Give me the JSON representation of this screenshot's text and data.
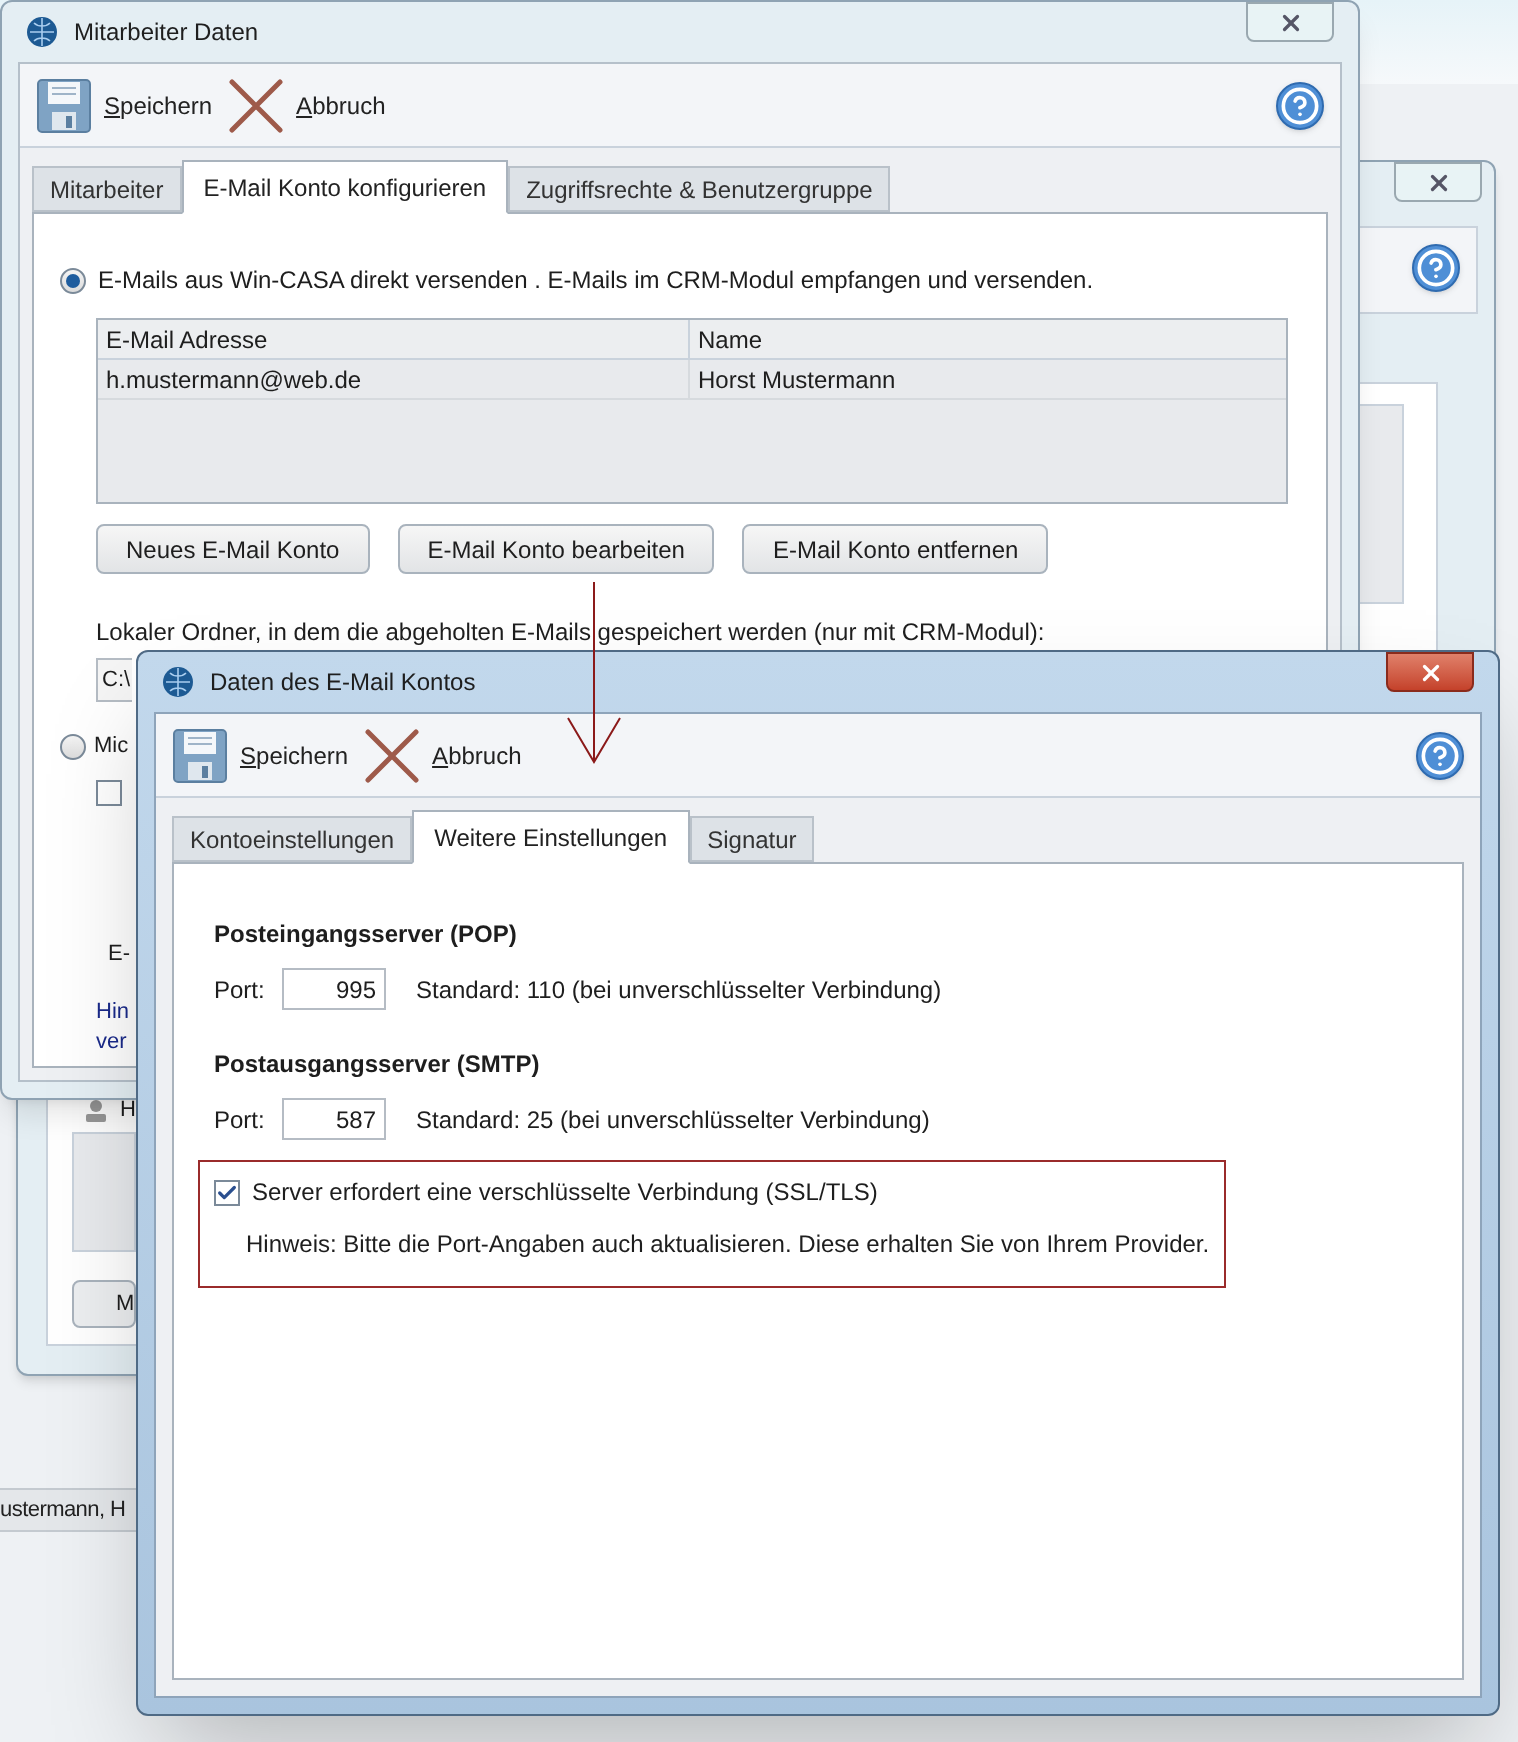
{
  "back_window": {
    "list_header": "H",
    "button": "M"
  },
  "status_bar": "ustermann, H",
  "main_window": {
    "title": "Mitarbeiter Daten",
    "toolbar": [
      {
        "label": "Speichern",
        "kind": "save"
      },
      {
        "label": "Abbruch",
        "kind": "cancel"
      }
    ],
    "tabs": [
      {
        "label": "Mitarbeiter",
        "selected": false
      },
      {
        "label": "E-Mail Konto konfigurieren",
        "selected": true
      },
      {
        "label": "Zugriffsrechte & Benutzergruppe",
        "selected": false
      }
    ],
    "radio_direct": {
      "label": "E-Mails aus Win-CASA direkt versenden . E-Mails im CRM-Modul empfangen und versenden.",
      "selected": true
    },
    "table": {
      "columns": [
        "E-Mail Adresse",
        "Name"
      ],
      "rows": [
        [
          "h.mustermann@web.de",
          "Horst Mustermann"
        ]
      ]
    },
    "buttons": [
      "Neues E-Mail Konto",
      "E-Mail Konto bearbeiten",
      "E-Mail Konto entfernen"
    ],
    "folder_label": "Lokaler Ordner, in dem die abgeholten E-Mails gespeichert werden (nur mit CRM-Modul):",
    "folder_path": "C:\\",
    "radio_outlook": {
      "label": "Mic",
      "selected": false
    },
    "checkbox": {
      "checked": false
    },
    "field_label": "E-",
    "hint": [
      "Hin",
      "ver"
    ]
  },
  "front_window": {
    "title": "Daten des E-Mail Kontos",
    "toolbar": [
      {
        "label": "Speichern",
        "kind": "save"
      },
      {
        "label": "Abbruch",
        "kind": "cancel"
      }
    ],
    "tabs": [
      {
        "label": "Kontoeinstellungen",
        "selected": false
      },
      {
        "label": "Weitere Einstellungen",
        "selected": true
      },
      {
        "label": "Signatur",
        "selected": false
      }
    ],
    "servers": [
      {
        "heading": "Posteingangsserver (POP)",
        "port_label": "Port:",
        "port": "995",
        "note": "Standard: 110 (bei unverschlüsselter Verbindung)"
      },
      {
        "heading": "Postausgangsserver (SMTP)",
        "port_label": "Port:",
        "port": "587",
        "note": "Standard: 25 (bei unverschlüsselter Verbindung)"
      }
    ],
    "ssl": {
      "label": "Server erfordert eine verschlüsselte Verbindung (SSL/TLS)",
      "checked": true,
      "hint": "Hinweis: Bitte die Port-Angaben auch aktualisieren. Diese erhalten Sie von Ihrem Provider."
    }
  }
}
